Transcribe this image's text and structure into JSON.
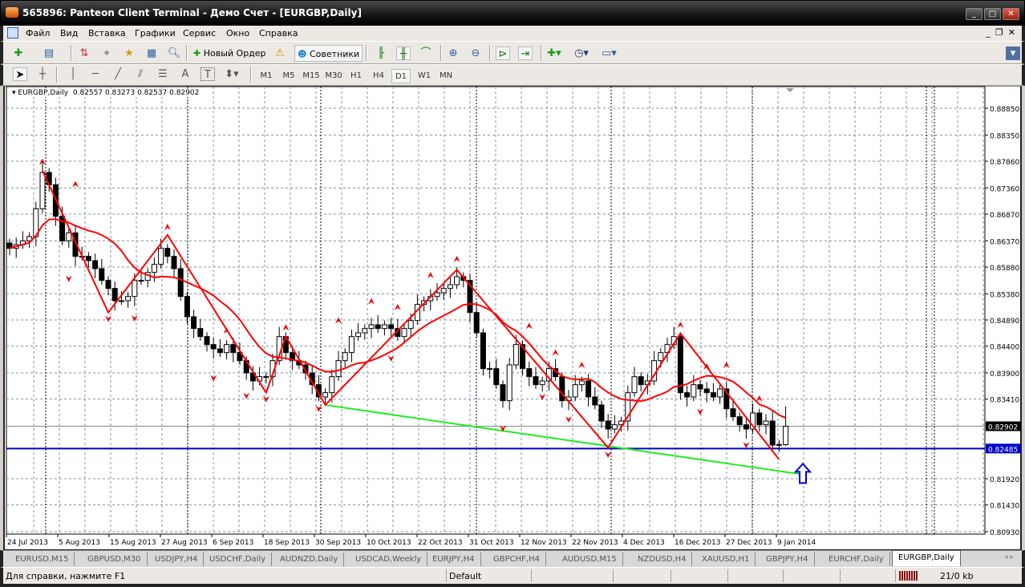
{
  "window": {
    "title": "565896: Panteon Client Terminal - Демо Счет - [EURGBP,Daily]",
    "minimize": "_",
    "maximize": "□",
    "close": "✕"
  },
  "menu": {
    "items": [
      "Файл",
      "Вид",
      "Вставка",
      "Графики",
      "Сервис",
      "Окно",
      "Справка"
    ],
    "mdi_min": "_",
    "mdi_restore": "❐",
    "mdi_close": "✕"
  },
  "toolbar": {
    "new_order": "Новый Ордер",
    "experts": "Советники"
  },
  "drawing_tools": {
    "text": "A",
    "label": "T"
  },
  "timeframes": {
    "items": [
      "M1",
      "M5",
      "M15",
      "M30",
      "H1",
      "H4",
      "D1",
      "W1",
      "MN"
    ],
    "active": "D1"
  },
  "chart": {
    "symbol": "EURGBP,Daily",
    "open": "0.82557",
    "high": "0.83273",
    "low": "0.82537",
    "close": "0.82902"
  },
  "chart_data": {
    "type": "candlestick",
    "symbol": "EURGBP",
    "timeframe": "Daily",
    "closes": [
      0.8623,
      0.863,
      0.8637,
      0.8645,
      0.8697,
      0.8765,
      0.8742,
      0.8683,
      0.8637,
      0.8652,
      0.8608,
      0.8608,
      0.86,
      0.8585,
      0.8563,
      0.8548,
      0.8525,
      0.8525,
      0.8533,
      0.8563,
      0.8563,
      0.8578,
      0.8593,
      0.8623,
      0.8608,
      0.8585,
      0.8533,
      0.8495,
      0.8473,
      0.8458,
      0.8443,
      0.8435,
      0.8428,
      0.8443,
      0.8428,
      0.8413,
      0.839,
      0.8375,
      0.8383,
      0.8383,
      0.8413,
      0.8458,
      0.8428,
      0.8413,
      0.8405,
      0.839,
      0.8368,
      0.8345,
      0.8353,
      0.8383,
      0.8413,
      0.8428,
      0.8458,
      0.8465,
      0.8473,
      0.848,
      0.8473,
      0.848,
      0.8473,
      0.8458,
      0.8473,
      0.8488,
      0.8518,
      0.8525,
      0.8533,
      0.854,
      0.8548,
      0.8555,
      0.857,
      0.8563,
      0.8503,
      0.8465,
      0.8398,
      0.8398,
      0.8368,
      0.8338,
      0.8405,
      0.8443,
      0.8398,
      0.8383,
      0.8368,
      0.8375,
      0.8398,
      0.8383,
      0.8338,
      0.8345,
      0.8368,
      0.8375,
      0.8345,
      0.833,
      0.83,
      0.8285,
      0.8293,
      0.83,
      0.8353,
      0.8383,
      0.8368,
      0.8375,
      0.8413,
      0.8428,
      0.8443,
      0.8458,
      0.8353,
      0.8345,
      0.8368,
      0.836,
      0.8353,
      0.8345,
      0.836,
      0.8323,
      0.8308,
      0.8293,
      0.8285,
      0.8315,
      0.8293,
      0.83,
      0.8255,
      0.8256,
      0.82902
    ],
    "last_bar": {
      "open": 0.82557,
      "high": 0.83273,
      "low": 0.82537,
      "close": 0.82902
    },
    "y_ticks": [
      "0.88850",
      "0.88350",
      "0.87860",
      "0.87360",
      "0.86870",
      "0.86370",
      "0.85880",
      "0.85380",
      "0.84890",
      "0.84400",
      "0.83900",
      "0.83410",
      "0.81920",
      "0.81430",
      "0.80930"
    ],
    "ylim": [
      0.8093,
      0.8885
    ],
    "x_ticks": [
      "24 Jul 2013",
      "5 Aug 2013",
      "15 Aug 2013",
      "27 Aug 2013",
      "6 Sep 2013",
      "18 Sep 2013",
      "30 Sep 2013",
      "10 Oct 2013",
      "22 Oct 2013",
      "31 Oct 2013",
      "12 Nov 2013",
      "22 Nov 2013",
      "4 Dec 2013",
      "16 Dec 2013",
      "27 Dec 2013",
      "9 Jan 2014"
    ],
    "bid_line": {
      "price": 0.82902,
      "label": "0.82902",
      "color": "#000000"
    },
    "horizontal_line": {
      "price": 0.82485,
      "label": "0.82485",
      "color": "#0000c8"
    },
    "trendline": {
      "from": {
        "bar": 48,
        "price": 0.833
      },
      "to": {
        "bar": 120,
        "price": 0.8201
      },
      "color": "#22ee22"
    },
    "zigzag": {
      "color": "#ff0000",
      "points": [
        [
          5,
          0.8768
        ],
        [
          15,
          0.8503
        ],
        [
          24,
          0.8648
        ],
        [
          39,
          0.8353
        ],
        [
          42,
          0.8458
        ],
        [
          48,
          0.833
        ],
        [
          68,
          0.8583
        ],
        [
          91,
          0.825
        ],
        [
          102,
          0.8464
        ],
        [
          117,
          0.8228
        ]
      ]
    },
    "moving_average": {
      "color": "#ff0000"
    },
    "fractals_up": [
      [
        5,
        0.8785
      ],
      [
        10,
        0.8743
      ],
      [
        24,
        0.8663
      ],
      [
        33,
        0.8469
      ],
      [
        42,
        0.8475
      ],
      [
        50,
        0.8488
      ],
      [
        55,
        0.8524
      ],
      [
        59,
        0.8513
      ],
      [
        64,
        0.8573
      ],
      [
        68,
        0.8603
      ],
      [
        79,
        0.8478
      ],
      [
        83,
        0.8428
      ],
      [
        87,
        0.8405
      ],
      [
        102,
        0.848
      ],
      [
        106,
        0.8402
      ],
      [
        109,
        0.8405
      ],
      [
        114,
        0.8342
      ]
    ],
    "fractals_down": [
      [
        9,
        0.8566
      ],
      [
        15,
        0.8491
      ],
      [
        19,
        0.8492
      ],
      [
        31,
        0.838
      ],
      [
        36,
        0.8347
      ],
      [
        39,
        0.8341
      ],
      [
        47,
        0.8323
      ],
      [
        58,
        0.8417
      ],
      [
        75,
        0.8286
      ],
      [
        81,
        0.8345
      ],
      [
        85,
        0.8303
      ],
      [
        91,
        0.8237
      ],
      [
        105,
        0.8317
      ],
      [
        112,
        0.8255
      ]
    ],
    "arrow_up": {
      "price": 0.8205,
      "color": "#0000c8"
    },
    "grid": true
  },
  "tabs": {
    "items": [
      "EURUSD,M15",
      "GBPUSD,M30",
      "USDJPY,H4",
      "USDCHF,Daily",
      "AUDNZD,Daily",
      "USDCAD,Weekly",
      "EURJPY,H4",
      "GBPCHF,H4",
      "AUDUSD,M15",
      "NZDUSD,H4",
      "XAUUSD,H1",
      "GBPJPY,H4",
      "EURCHF,Daily",
      "EURGBP,Daily"
    ],
    "active": "EURGBP,Daily",
    "scroll": "◂ ▸"
  },
  "status": {
    "help": "Для справки, нажмите F1",
    "profile": "Default",
    "traffic": "21/0 kb"
  }
}
